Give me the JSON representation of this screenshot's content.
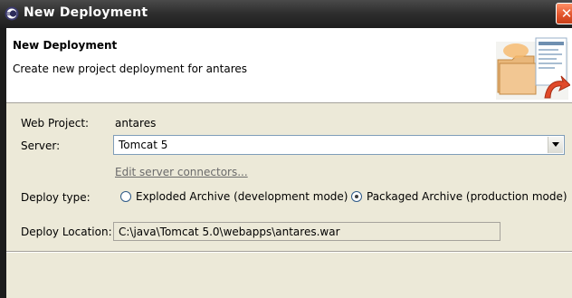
{
  "window": {
    "title": "New Deployment",
    "icons": {
      "app": "eclipse-icon",
      "close": "close-icon"
    }
  },
  "header": {
    "title": "New Deployment",
    "description": "Create new project deployment for antares",
    "graphic": "deployment-wizard-graphic"
  },
  "form": {
    "web_project_label": "Web Project:",
    "web_project_value": "antares",
    "server_label": "Server:",
    "server_value": "Tomcat 5",
    "edit_link": "Edit server connectors...",
    "deploy_type_label": "Deploy type:",
    "deploy_type_options": [
      {
        "label": "Exploded Archive (development mode)",
        "checked": false
      },
      {
        "label": "Packaged Archive (production mode)",
        "checked": true
      }
    ],
    "deploy_location_label": "Deploy Location:",
    "deploy_location_value": "C:\\java\\Tomcat 5.0\\webapps\\antares.war"
  },
  "colors": {
    "dialog_bg": "#ece9d8",
    "titlebar": "#2f2f2f",
    "close_button": "#e0522a",
    "input_border": "#7f9db9"
  }
}
